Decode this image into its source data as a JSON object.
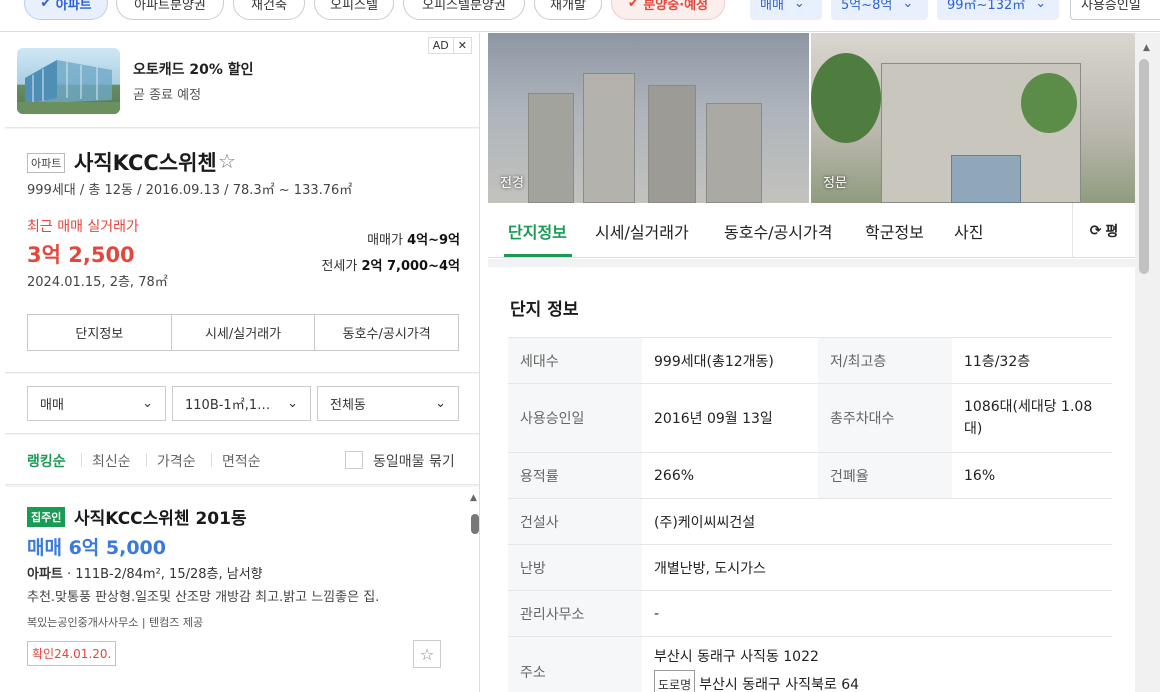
{
  "filterbar": {
    "chips": [
      "아파트",
      "아파트분양권",
      "재건축",
      "오피스텔",
      "오피스텔분양권",
      "재개발",
      "분양중·예정"
    ],
    "deal_type": "매매",
    "price_range": "5억~8억",
    "area_range": "99㎡~132㎡",
    "approval_label": "사용승인일"
  },
  "ad": {
    "badge": "AD",
    "title": "오토캐드 20% 할인",
    "subtitle": "곧 종료 예정"
  },
  "complex": {
    "type_tag": "아파트",
    "name": "사직KCC스위첸",
    "meta": "999세대 / 총 12동 / 2016.09.13 / 78.3㎡ ~ 133.76㎡",
    "recent_label": "최근 매매 실거래가",
    "recent_price": "3억 2,500",
    "recent_date": "2024.01.15, 2층, 78㎡",
    "sale_label": "매매가",
    "sale_value": "4억~9억",
    "jeonse_label": "전세가",
    "jeonse_value": "2억 7,000~4억",
    "tabs": [
      "단지정보",
      "시세/실거래가",
      "동호수/공시가격"
    ]
  },
  "filters": {
    "deal": "매매",
    "area": "110B-1㎡,1…",
    "dong": "전체동"
  },
  "sort": {
    "items": [
      "랭킹순",
      "최신순",
      "가격순",
      "면적순"
    ],
    "group_label": "동일매물 묶기"
  },
  "listing": {
    "tag": "집주인",
    "title": "사직KCC스위첸 201동",
    "price": "매매 6억 5,000",
    "type": "아파트",
    "info": "111B-2/84m², 15/28층, 남서향",
    "desc": "추천.맞통풍 판상형.일조및 산조망 개방감 최고.밝고 느낌좋은 집.",
    "agent": "복있는공인중개사사무소",
    "provider": "텐컴즈 제공",
    "confirm": "확인24.01.20."
  },
  "photos": {
    "label1": "전경",
    "label2": "정문"
  },
  "detail": {
    "tabs": [
      "단지정보",
      "시세/실거래가",
      "동호수/공시가격",
      "학군정보",
      "사진"
    ],
    "unit_toggle": "평",
    "section_title": "단지 정보",
    "rows": [
      {
        "k1": "세대수",
        "v1": "999세대(총12개동)",
        "k2": "저/최고층",
        "v2": "11층/32층"
      },
      {
        "k1": "사용승인일",
        "v1": "2016년 09월 13일",
        "k2": "총주차대수",
        "v2": "1086대(세대당 1.08대)"
      },
      {
        "k1": "용적률",
        "v1": "266%",
        "k2": "건폐율",
        "v2": "16%"
      }
    ],
    "builder_label": "건설사",
    "builder": "(주)케이씨씨건설",
    "heating_label": "난방",
    "heating": "개별난방, 도시가스",
    "office_label": "관리사무소",
    "office": "-",
    "address_label": "주소",
    "address": "부산시 동래구 사직동 1022",
    "road_tag": "도로명",
    "road_address": "부산시 동래구 사직북로 64"
  }
}
